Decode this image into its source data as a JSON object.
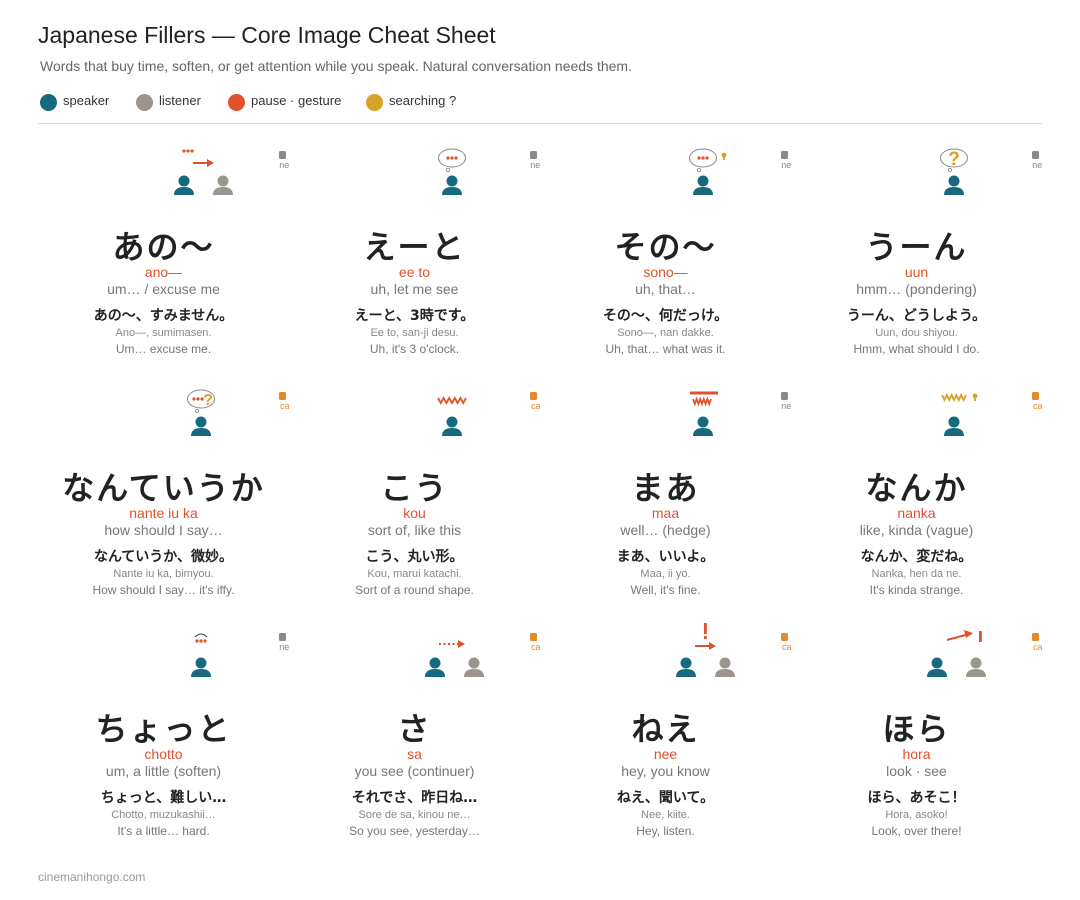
{
  "title": "Japanese Fillers — Core Image Cheat Sheet",
  "subtitle": "Words that buy time, soften, or get attention while you speak. Natural conversation needs them.",
  "legend": [
    {
      "label": "speaker",
      "color": "#176a7e"
    },
    {
      "label": "listener",
      "color": "#9a968e"
    },
    {
      "label": "pause · gesture",
      "color": "#e0522a"
    },
    {
      "label": "searching ?",
      "color": "#d9a227"
    }
  ],
  "colors": {
    "speaker": "#176a7e",
    "listener": "#9a968e",
    "pause": "#e0522a",
    "search": "#d9a227",
    "casual": "#e38a2e",
    "neutral_bar": "#8a8a84",
    "bar_light": "#dcdad6"
  },
  "cards": [
    {
      "jp": "あの〜",
      "romaji": "ano—",
      "meaning": "um… / excuse me",
      "ex_jp": "あの〜、すみません。",
      "ex_romaji": "Ano—, sumimasen.",
      "ex_en": "Um… excuse me.",
      "register": "neutral",
      "icon": "speaker-listener-arrow-dots"
    },
    {
      "jp": "えーと",
      "romaji": "ee to",
      "meaning": "uh, let me see",
      "ex_jp": "えーと、3時です。",
      "ex_romaji": "Ee to, san-ji desu.",
      "ex_en": "Uh, it's 3 o'clock.",
      "register": "neutral",
      "icon": "thought-bubble-dots"
    },
    {
      "jp": "その〜",
      "romaji": "sono—",
      "meaning": "uh, that…",
      "ex_jp": "その〜、何だっけ。",
      "ex_romaji": "Sono—, nan dakke.",
      "ex_en": "Uh, that… what was it.",
      "register": "neutral",
      "icon": "thought-bubble-dots-exclaim"
    },
    {
      "jp": "うーん",
      "romaji": "uun",
      "meaning": "hmm… (pondering)",
      "ex_jp": "うーん、どうしよう。",
      "ex_romaji": "Uun, dou shiyou.",
      "ex_en": "Hmm, what should I do.",
      "register": "neutral",
      "icon": "thought-bubble-question"
    },
    {
      "jp": "なんていうか",
      "romaji": "nante iu ka",
      "meaning": "how should I say…",
      "ex_jp": "なんていうか、微妙。",
      "ex_romaji": "Nante iu ka, bimyou.",
      "ex_en": "How should I say… it's iffy.",
      "register": "casual",
      "icon": "thought-bubble-dots-question"
    },
    {
      "jp": "こう",
      "romaji": "kou",
      "meaning": "sort of, like this",
      "ex_jp": "こう、丸い形。",
      "ex_romaji": "Kou, marui katachi.",
      "ex_en": "Sort of a round shape.",
      "register": "casual",
      "icon": "zigzag-gesture"
    },
    {
      "jp": "まあ",
      "romaji": "maa",
      "meaning": "well… (hedge)",
      "ex_jp": "まあ、いいよ。",
      "ex_romaji": "Maa, ii yo.",
      "ex_en": "Well, it's fine.",
      "register": "neutral",
      "icon": "bar-zigzag-hedge"
    },
    {
      "jp": "なんか",
      "romaji": "nanka",
      "meaning": "like, kinda (vague)",
      "ex_jp": "なんか、変だね。",
      "ex_romaji": "Nanka, hen da ne.",
      "ex_en": "It's kinda strange.",
      "register": "casual",
      "icon": "zigzag-search"
    },
    {
      "jp": "ちょっと",
      "romaji": "chotto",
      "meaning": "um, a little (soften)",
      "ex_jp": "ちょっと、難しい…",
      "ex_romaji": "Chotto, muzukashii…",
      "ex_en": "It's a little… hard.",
      "register": "neutral",
      "icon": "dots-arc"
    },
    {
      "jp": "さ",
      "romaji": "sa",
      "meaning": "you see (continuer)",
      "ex_jp": "それでさ、昨日ね…",
      "ex_romaji": "Sore de sa, kinou ne…",
      "ex_en": "So you see, yesterday…",
      "register": "casual",
      "icon": "speaker-listener-dotted-arrow"
    },
    {
      "jp": "ねえ",
      "romaji": "nee",
      "meaning": "hey, you know",
      "ex_jp": "ねえ、聞いて。",
      "ex_romaji": "Nee, kiite.",
      "ex_en": "Hey, listen.",
      "register": "casual",
      "icon": "speaker-listener-exclaim-arrow"
    },
    {
      "jp": "ほら",
      "romaji": "hora",
      "meaning": "look · see",
      "ex_jp": "ほら、あそこ！",
      "ex_romaji": "Hora, asoko!",
      "ex_en": "Look, over there!",
      "register": "casual",
      "icon": "speaker-listener-pointing"
    }
  ],
  "footer": "cinemanihongo.com"
}
